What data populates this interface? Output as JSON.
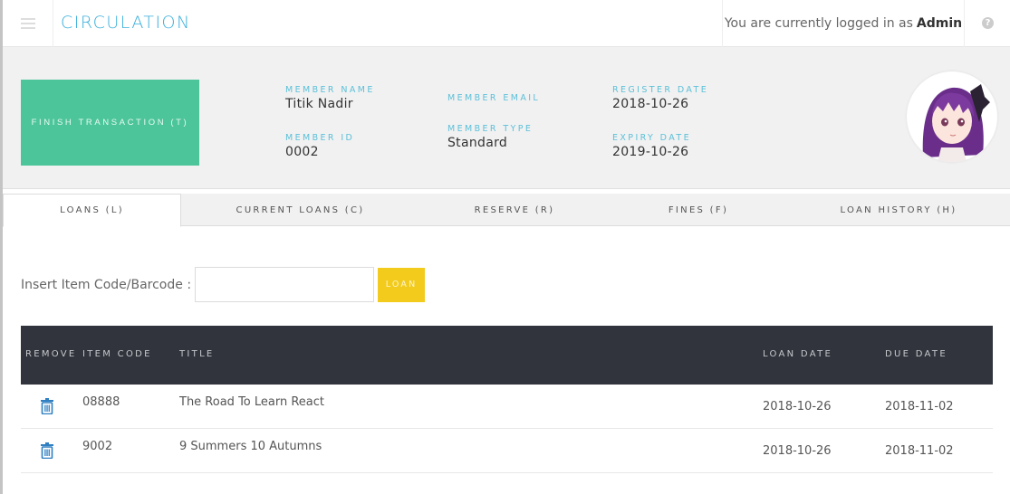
{
  "header": {
    "menu_icon": "hamburger-icon",
    "title": "CIRCULATION",
    "login_prefix": "You are currently logged in as",
    "login_user": "Admin",
    "help_icon": "question-circle-icon",
    "help_glyph": "?"
  },
  "member": {
    "finish_button": "FINISH TRANSACTION (T)",
    "name_label": "MEMBER NAME",
    "name": "Titik Nadir",
    "id_label": "MEMBER ID",
    "id": "0002",
    "email_label": "MEMBER EMAIL",
    "email": "",
    "type_label": "MEMBER TYPE",
    "type": "Standard",
    "register_label": "REGISTER DATE",
    "register_date": "2018-10-26",
    "expiry_label": "EXPIRY DATE",
    "expiry_date": "2019-10-26",
    "avatar": "member-avatar-anime-girl"
  },
  "tabs": [
    {
      "label": "LOANS (L)",
      "active": true
    },
    {
      "label": "CURRENT LOANS (C)",
      "active": false
    },
    {
      "label": "RESERVE (R)",
      "active": false
    },
    {
      "label": "FINES (F)",
      "active": false
    },
    {
      "label": "LOAN HISTORY (H)",
      "active": false
    }
  ],
  "loan_form": {
    "label": "Insert Item Code/Barcode :",
    "input_value": "",
    "input_placeholder": "",
    "button": "LOAN"
  },
  "table": {
    "columns": [
      "REMOVE",
      "ITEM CODE",
      "TITLE",
      "LOAN DATE",
      "DUE DATE"
    ],
    "rows": [
      {
        "item_code": "08888",
        "title": "The Road To Learn React",
        "loan_date": "2018-10-26",
        "due_date": "2018-11-02"
      },
      {
        "item_code": "9002",
        "title": "9 Summers 10 Autumns",
        "loan_date": "2018-10-26",
        "due_date": "2018-11-02"
      }
    ]
  },
  "colors": {
    "accent": "#3aaedb",
    "finish_button": "#4cc59a",
    "loan_button": "#f2cb1d",
    "table_header": "#31343c",
    "trash_icon": "#2f7fc1"
  }
}
